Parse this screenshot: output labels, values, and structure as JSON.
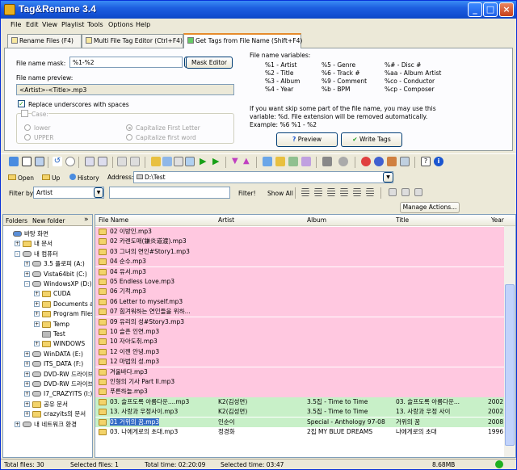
{
  "window": {
    "title": "Tag&Rename 3.4"
  },
  "menu": [
    "File",
    "Edit",
    "View",
    "Playlist",
    "Tools",
    "Options",
    "Help"
  ],
  "tabs": [
    {
      "label": "Rename Files (F4)"
    },
    {
      "label": "Multi File Tag Editor (Ctrl+F4)"
    },
    {
      "label": "Get Tags from File Name (Shift+F4)"
    }
  ],
  "panel": {
    "mask_label": "File name mask:",
    "mask_value": "%1-%2",
    "mask_editor": "Mask Editor",
    "preview_label": "File name preview:",
    "preview_value": "<Artist>-<Title>.mp3",
    "replace_underscores": "Replace underscores with spaces",
    "case_label": "Case:",
    "case_options": [
      "lower",
      "UPPER",
      "Capitalize First Letter",
      "Capitalize first word"
    ],
    "vars_title": "File name variables:",
    "vars": [
      [
        "%1 - Artist",
        "%5 - Genre",
        "%# - Disc #"
      ],
      [
        "%2 - Title",
        "%6 - Track #",
        "%aa - Album Artist"
      ],
      [
        "%3 - Album",
        "%9 - Comment",
        "%co - Conductor"
      ],
      [
        "%4 - Year",
        "%b - BPM",
        "%cp - Composer"
      ]
    ],
    "note1": "If you want skip some part of the file name, you may use this",
    "note2": "variable: %d. File extension will be removed automatically.",
    "note3": "Example: %6 %1 - %2",
    "preview_btn": "Preview",
    "write_btn": "Write Tags"
  },
  "nav": {
    "open": "Open",
    "up": "Up",
    "history": "History",
    "address_label": "Address:",
    "address_value": "D:\\Test",
    "filter_label": "Filter by",
    "filter_value": "Artist",
    "filter_btn": "Filter!",
    "show_all": "Show All",
    "manage_actions": "Manage Actions..."
  },
  "tree": {
    "folders_btn": "Folders",
    "new_folder_btn": "New folder",
    "items": [
      {
        "label": "바탕 화면"
      },
      {
        "label": "내 문서"
      },
      {
        "label": "내 컴퓨터"
      },
      {
        "label": "3.5 플로피 (A:)"
      },
      {
        "label": "Vista64bit (C:)"
      },
      {
        "label": "WindowsXP (D:)"
      },
      {
        "label": "CUDA"
      },
      {
        "label": "Documents and"
      },
      {
        "label": "Program Files"
      },
      {
        "label": "Temp"
      },
      {
        "label": "Test"
      },
      {
        "label": "WINDOWS"
      },
      {
        "label": "WinDATA (E:)"
      },
      {
        "label": "ITS_DATA (F:)"
      },
      {
        "label": "DVD-RW 드라이브"
      },
      {
        "label": "DVD-RW 드라이브"
      },
      {
        "label": "I7_CRAZYITS (I:)"
      },
      {
        "label": "공유 문서"
      },
      {
        "label": "crazyits의 문서"
      },
      {
        "label": "내 네트워크 환경"
      }
    ]
  },
  "grid": {
    "columns": [
      "File Name",
      "Artist",
      "Album",
      "Title",
      "Year"
    ],
    "rows": [
      [
        "02 이방인.mp3",
        "",
        "",
        "",
        ""
      ],
      [
        "02 카렌도매(鎌炎道渡).mp3",
        "",
        "",
        "",
        ""
      ],
      [
        "03 그녀의 연인#Story1.mp3",
        "",
        "",
        "",
        ""
      ],
      [
        "04 순수.mp3",
        "",
        "",
        "",
        ""
      ],
      [
        "04 유서.mp3",
        "",
        "",
        "",
        ""
      ],
      [
        "05 Endless Love.mp3",
        "",
        "",
        "",
        ""
      ],
      [
        "06 기적.mp3",
        "",
        "",
        "",
        ""
      ],
      [
        "06 Letter to myself.mp3",
        "",
        "",
        "",
        ""
      ],
      [
        "07 힘겨워하는 연인들을 위하...",
        "",
        "",
        "",
        ""
      ],
      [
        "09 유리의 성#Story3.mp3",
        "",
        "",
        "",
        ""
      ],
      [
        "10 슬픈 인연.mp3",
        "",
        "",
        "",
        ""
      ],
      [
        "10 자아도취.mp3",
        "",
        "",
        "",
        ""
      ],
      [
        "12 이젠 안녕.mp3",
        "",
        "",
        "",
        ""
      ],
      [
        "12 마법의 성.mp3",
        "",
        "",
        "",
        ""
      ],
      [
        "겨울바다.mp3",
        "",
        "",
        "",
        ""
      ],
      [
        "인형의 기사 Part II.mp3",
        "",
        "",
        "",
        ""
      ],
      [
        "푸른하늘.mp3",
        "",
        "",
        "",
        ""
      ],
      [
        "03. 슬프도록 아름다운....mp3",
        "K2(김성면)",
        "3.5집 - Time to Time",
        "03. 슬프도록 아름다운...",
        "2002"
      ],
      [
        "13. 사랑과 우정사이.mp3",
        "K2(김성면)",
        "3.5집 - Time to Time",
        "13. 사랑과 우정 사이",
        "2002"
      ],
      [
        "01 거위의 꿈.mp3",
        "인순이",
        "Special - Anthology 97-08",
        "거위의 꿈",
        "2008"
      ],
      [
        "03. 나에게로의 초대.mp3",
        "정경화",
        "2집 MY BLUE DREAMS",
        "나에게로의 초대",
        "1996"
      ]
    ]
  },
  "status": {
    "total_files": "Total files: 30",
    "selected_files": "Selected files: 1",
    "total_time": "Total time: 02:20:09",
    "selected_time": "Selected time: 03:47",
    "size": "8.68MB"
  }
}
